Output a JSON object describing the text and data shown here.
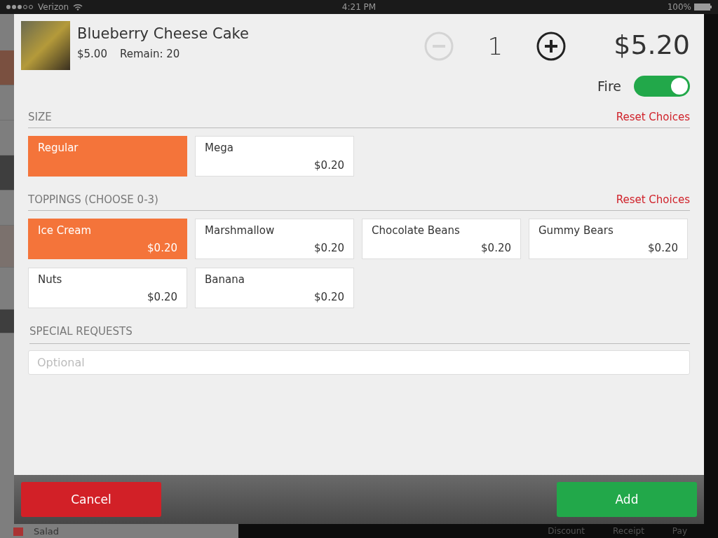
{
  "status_bar": {
    "carrier": "Verizon",
    "time": "4:21 PM",
    "battery": "100%"
  },
  "background": {
    "sidebar_item": "Salad",
    "bottom_tabs": [
      "Discount",
      "Receipt",
      "Pay"
    ]
  },
  "item": {
    "name": "Blueberry Cheese Cake",
    "price": "$5.00",
    "remain": "Remain: 20",
    "quantity": "1",
    "decrement_disabled": true,
    "total": "$5.20"
  },
  "fire": {
    "label": "Fire",
    "on": true
  },
  "sections": [
    {
      "title": "SIZE",
      "reset": "Reset Choices",
      "options": [
        {
          "name": "Regular",
          "selected": true
        },
        {
          "name": "Mega",
          "price": "$0.20",
          "selected": false
        }
      ]
    },
    {
      "title": "TOPPINGS (CHOOSE 0-3)",
      "reset": "Reset Choices",
      "options": [
        {
          "name": "Ice Cream",
          "price": "$0.20",
          "selected": true
        },
        {
          "name": "Marshmallow",
          "price": "$0.20",
          "selected": false
        },
        {
          "name": "Chocolate Beans",
          "price": "$0.20",
          "selected": false
        },
        {
          "name": "Gummy Bears",
          "price": "$0.20",
          "selected": false
        },
        {
          "name": "Nuts",
          "price": "$0.20",
          "selected": false
        },
        {
          "name": "Banana",
          "price": "$0.20",
          "selected": false
        }
      ]
    }
  ],
  "special_requests": {
    "title": "SPECIAL REQUESTS",
    "placeholder": "Optional"
  },
  "buttons": {
    "cancel": "Cancel",
    "add": "Add"
  }
}
